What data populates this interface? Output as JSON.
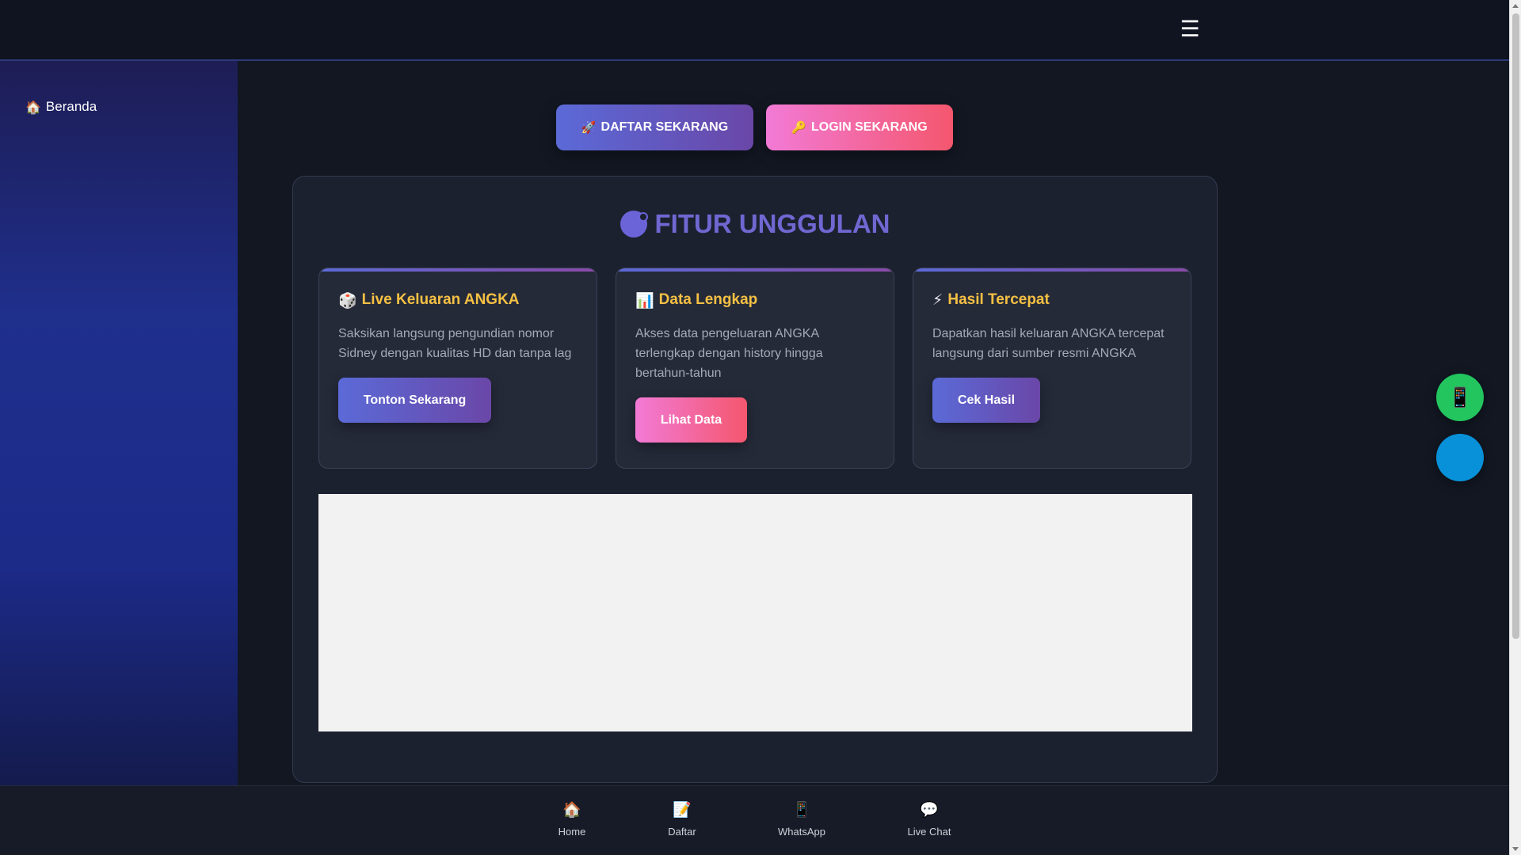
{
  "header": {
    "menu_icon": "☰"
  },
  "sidebar": {
    "items": [
      {
        "icon": "🏠",
        "label": "Beranda"
      }
    ]
  },
  "cta": {
    "daftar": {
      "icon": "🚀",
      "label": "DAFTAR SEKARANG"
    },
    "login": {
      "icon": "🔑",
      "label": "LOGIN SEKARANG"
    }
  },
  "features": {
    "title": "FITUR UNGGULAN",
    "cards": [
      {
        "icon": "🎲",
        "title": "Live Keluaran ANGKA",
        "description": "Saksikan langsung pengundian nomor Sidney dengan kualitas HD dan tanpa lag",
        "button": "Tonton Sekarang"
      },
      {
        "icon": "📊",
        "title": "Data Lengkap",
        "description": "Akses data pengeluaran ANGKA terlengkap dengan history hingga bertahun-tahun",
        "button": "Lihat Data"
      },
      {
        "icon": "⚡",
        "title": "Hasil Tercepat",
        "description": "Dapatkan hasil keluaran ANGKA tercepat langsung dari sumber resmi ANGKA",
        "button": "Cek Hasil"
      }
    ]
  },
  "floating": {
    "whatsapp_icon": "📱",
    "telegram_icon": ""
  },
  "bottom_nav": [
    {
      "icon": "🏠",
      "label": "Home"
    },
    {
      "icon": "📝",
      "label": "Daftar"
    },
    {
      "icon": "📱",
      "label": "WhatsApp"
    },
    {
      "icon": "💬",
      "label": "Live Chat"
    }
  ],
  "colors": {
    "accent_purple": "#5b6ad7",
    "accent_pink": "#f27ad6",
    "title_color": "#7068d2",
    "card_title_color": "#f5c043",
    "whatsapp_green": "#22c55e",
    "telegram_blue": "#0891d8"
  }
}
